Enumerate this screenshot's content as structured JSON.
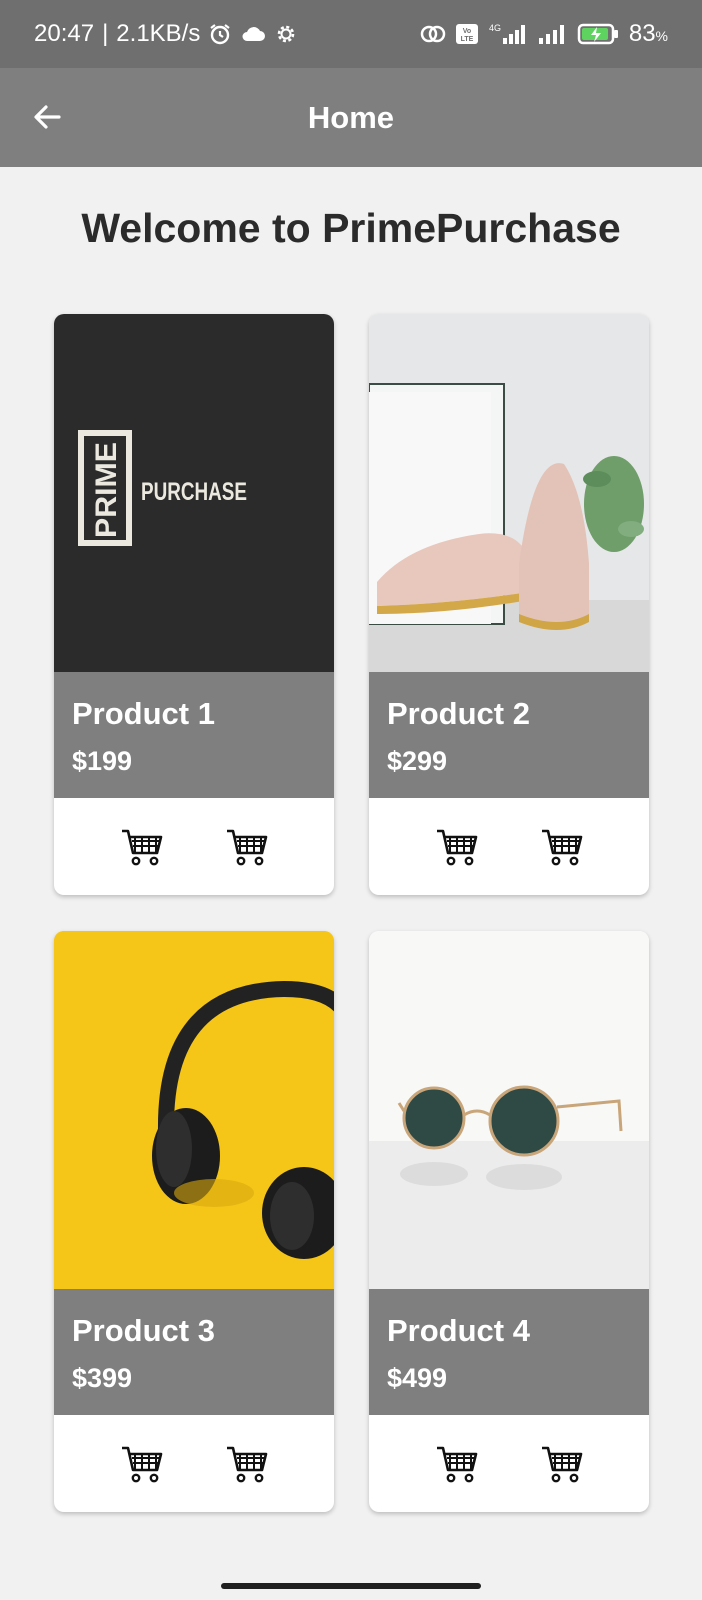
{
  "status_bar": {
    "time": "20:47",
    "network_speed": "2.1KB/s",
    "battery": "83",
    "battery_unit": "%",
    "network_type": "4G",
    "volte": "Vo LTE"
  },
  "app_bar": {
    "title": "Home"
  },
  "welcome_text": "Welcome to PrimePurchase",
  "products": [
    {
      "name": "Product 1",
      "price": "$199"
    },
    {
      "name": "Product 2",
      "price": "$299"
    },
    {
      "name": "Product 3",
      "price": "$399"
    },
    {
      "name": "Product 4",
      "price": "$499"
    }
  ],
  "logo": {
    "word1": "PRIME",
    "word2": "PURCHASE"
  },
  "colors": {
    "status_bar": "#6f6f6f",
    "app_bar": "#7f7f7f",
    "background": "#f1f1f1",
    "info_panel": "#7f7f7f",
    "logo_bg": "#2b2b2b",
    "headphones_bg": "#f5c518"
  },
  "icons": {
    "back": "arrow-left-icon",
    "cart": "shopping-cart-icon",
    "alarm": "alarm-clock-icon",
    "cloud": "cloud-icon",
    "settings": "gear-icon",
    "signal": "signal-icon",
    "battery": "battery-charging-icon"
  }
}
